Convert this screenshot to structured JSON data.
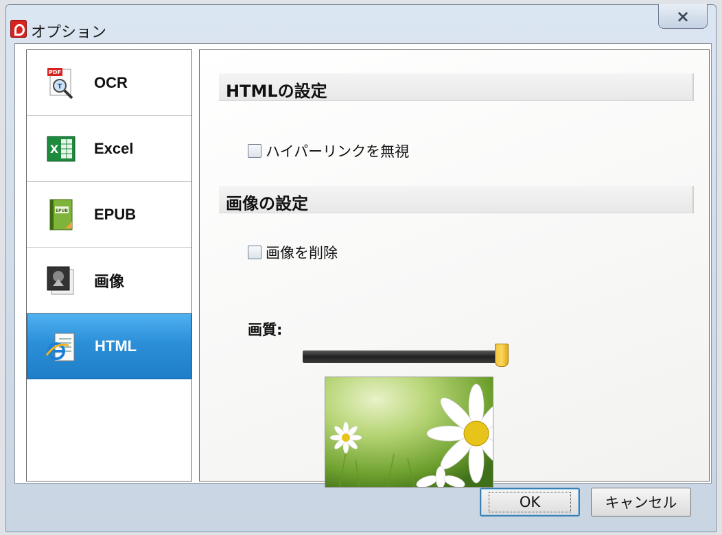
{
  "window": {
    "title": "オプション",
    "close_label": "×"
  },
  "sidebar": {
    "items": [
      {
        "label": "OCR",
        "icon": "ocr-pdf-icon"
      },
      {
        "label": "Excel",
        "icon": "excel-icon"
      },
      {
        "label": "EPUB",
        "icon": "epub-book-icon"
      },
      {
        "label": "画像",
        "icon": "image-icon"
      },
      {
        "label": "HTML",
        "icon": "html-ie-icon",
        "selected": true
      }
    ]
  },
  "panel": {
    "html_section_title": "HTMLの設定",
    "ignore_hyperlink_label": "ハイパーリンクを無視",
    "ignore_hyperlink_checked": false,
    "image_section_title": "画像の設定",
    "delete_image_label": "画像を削除",
    "delete_image_checked": false,
    "quality_label": "画質:",
    "quality_value_fraction": 0.98
  },
  "buttons": {
    "ok_label": "OK",
    "cancel_label": "キャンセル"
  },
  "colors": {
    "selected_item": "#2b8fd8",
    "slider_thumb": "#f4c23a"
  }
}
